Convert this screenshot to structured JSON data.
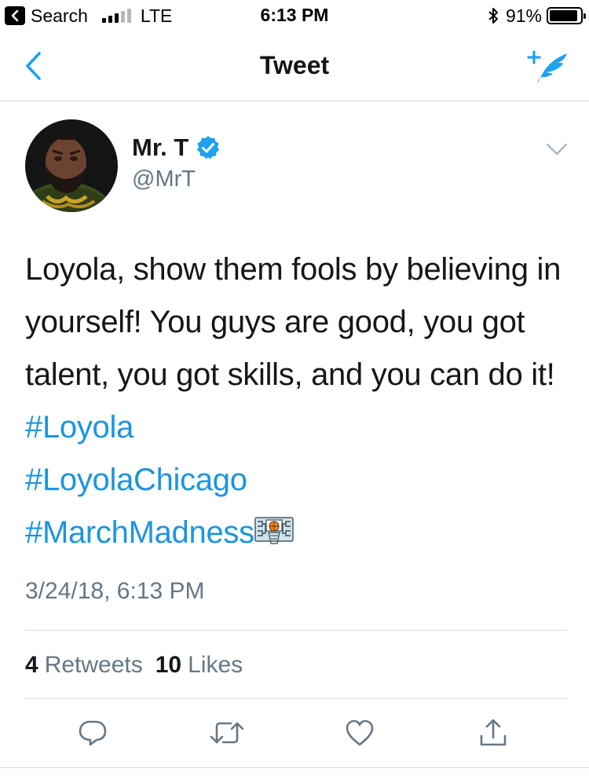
{
  "status_bar": {
    "back_app": "Search",
    "carrier": "LTE",
    "time": "6:13 PM",
    "battery": "91%",
    "battery_level": 0.91
  },
  "nav": {
    "title": "Tweet",
    "back_icon": "chevron-left-icon",
    "compose_icon": "compose-tweet-icon"
  },
  "tweet": {
    "author_name": "Mr. T",
    "author_handle": "@MrT",
    "verified": true,
    "text_plain": "Loyola, show them fools by believing in yourself! You guys are good, you got talent, you got skills, and you can do it!",
    "hashtags": [
      "#Loyola",
      "#LoyolaChicago",
      "#MarchMadness"
    ],
    "emoji": "basketball-bracket-emoji",
    "timestamp": "3/24/18, 6:13 PM",
    "retweets_count": "4",
    "retweets_label": "Retweets",
    "likes_count": "10",
    "likes_label": "Likes"
  },
  "actions": [
    "reply-icon",
    "retweet-icon",
    "like-icon",
    "share-icon"
  ],
  "colors": {
    "link": "#1b95e0",
    "secondary_text": "#657786",
    "primary_text": "#14171a",
    "divider": "#d8dce0",
    "verified": "#1da1f2"
  }
}
